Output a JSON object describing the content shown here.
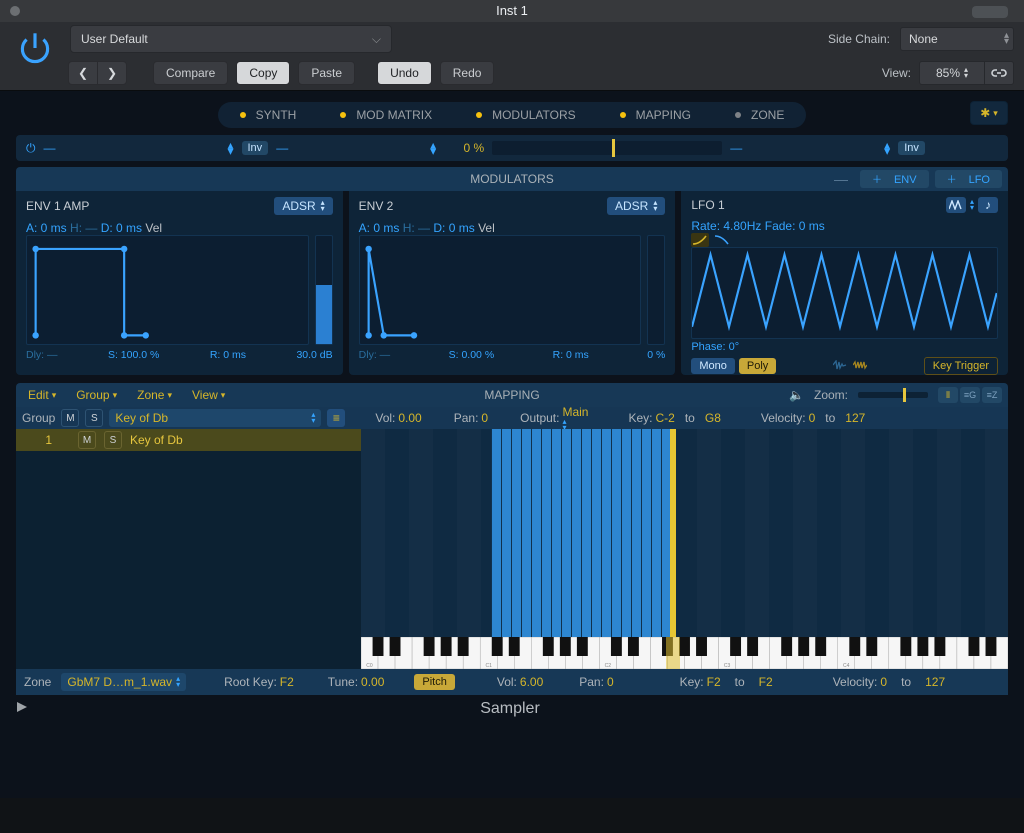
{
  "window": {
    "title": "Inst 1"
  },
  "preset": {
    "name": "User Default"
  },
  "side_chain": {
    "label": "Side Chain:",
    "value": "None"
  },
  "toolbar": {
    "compare": "Compare",
    "copy": "Copy",
    "paste": "Paste",
    "undo": "Undo",
    "redo": "Redo",
    "view_label": "View:",
    "view_pct": "85%"
  },
  "section_tabs": {
    "synth": "SYNTH",
    "mod_matrix": "MOD MATRIX",
    "modulators": "MODULATORS",
    "mapping": "MAPPING",
    "zone": "ZONE"
  },
  "mod_row": {
    "src1": "—",
    "inv1": "Inv",
    "dest": "—",
    "amount_pct": "0 %",
    "src2": "—",
    "inv2": "Inv"
  },
  "modulators": {
    "title": "MODULATORS",
    "add_env": "ENV",
    "add_lfo": "LFO",
    "env1": {
      "name": "ENV 1 AMP",
      "mode": "ADSR",
      "a": "A: 0 ms",
      "h": "H: —",
      "d": "D: 0 ms",
      "vel": "Vel",
      "dly": "Dly: —",
      "s": "S: 100.0 %",
      "r": "R: 0 ms",
      "db": "30.0 dB"
    },
    "env2": {
      "name": "ENV 2",
      "mode": "ADSR",
      "a": "A: 0 ms",
      "h": "H: —",
      "d": "D: 0 ms",
      "vel": "Vel",
      "dly": "Dly: —",
      "s": "S: 0.00 %",
      "r": "R: 0 ms",
      "pct": "0 %"
    },
    "lfo1": {
      "name": "LFO 1",
      "rate": "Rate: 4.80Hz",
      "fade": "Fade: 0 ms",
      "phase": "Phase: 0°",
      "mono": "Mono",
      "poly": "Poly",
      "key_trigger": "Key Trigger"
    }
  },
  "mapping_hdr": {
    "edit": "Edit",
    "group": "Group",
    "zone": "Zone",
    "view": "View",
    "title": "MAPPING",
    "zoom": "Zoom:"
  },
  "group_strip": {
    "group": "Group",
    "m": "M",
    "s": "S",
    "name": "Key of Db",
    "vol_k": "Vol:",
    "vol_v": "0.00",
    "pan_k": "Pan:",
    "pan_v": "0",
    "out_k": "Output:",
    "out_v": "Main",
    "key_k": "Key:",
    "key_lo": "C-2",
    "to": "to",
    "key_hi": "G8",
    "vel_k": "Velocity:",
    "vel_lo": "0",
    "vel_hi": "127"
  },
  "map_list": {
    "row": {
      "index": "1",
      "m": "M",
      "s": "S",
      "name": "Key of Db"
    }
  },
  "piano_octaves": [
    "C0",
    "C1",
    "C2",
    "C3",
    "C4"
  ],
  "zone_strip": {
    "zone": "Zone",
    "file": "GbM7 D…m_1.wav",
    "root_k": "Root Key:",
    "root_v": "F2",
    "tune_k": "Tune:",
    "tune_v": "0.00",
    "pitch": "Pitch",
    "vol_k": "Vol:",
    "vol_v": "6.00",
    "pan_k": "Pan:",
    "pan_v": "0",
    "key_k": "Key:",
    "key_lo": "F2",
    "to": "to",
    "key_hi": "F2",
    "vel_k": "Velocity:",
    "vel_lo": "0",
    "vel_hi": "127"
  },
  "footer": {
    "sampler": "Sampler"
  }
}
